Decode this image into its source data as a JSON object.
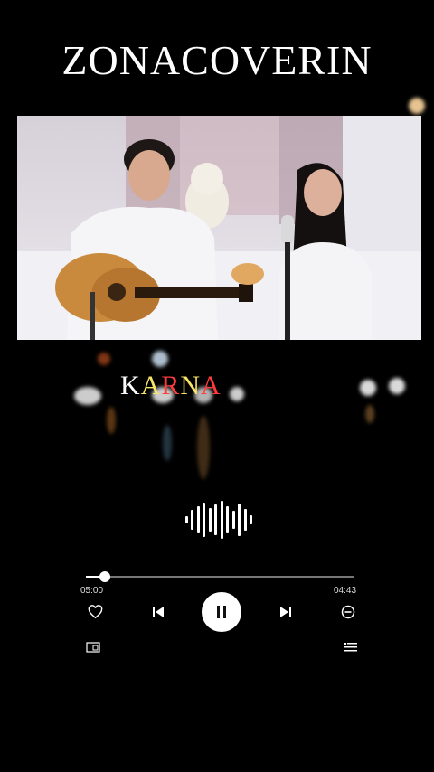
{
  "channel": {
    "title": "ZONACOVERIN"
  },
  "lyric": {
    "letters": [
      "K",
      "A",
      "R",
      "N",
      "A"
    ],
    "colors": [
      "#ffffff",
      "#f5e66a",
      "#ff3b3b",
      "#f5e66a",
      "#ff3b3b"
    ]
  },
  "player": {
    "elapsed": "05:00",
    "duration": "04:43",
    "progress": 0.07
  },
  "icons": {
    "like": "heart-icon",
    "previous": "skip-previous-icon",
    "play_pause": "pause-icon",
    "next": "skip-next-icon",
    "remove": "minus-circle-icon",
    "screen": "screen-mirror-icon",
    "playlist": "playlist-icon"
  },
  "colors": {
    "background": "#000000",
    "accent": "#ffffff"
  }
}
